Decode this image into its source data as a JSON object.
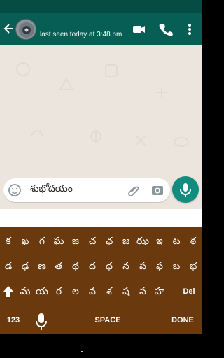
{
  "contact": {
    "last_seen": "last seen today at 3:48 pm"
  },
  "composer": {
    "message": "శుభోదయం"
  },
  "keyboard": {
    "row1": [
      "క",
      "ఖ",
      "గ",
      "ఘ",
      "జ",
      "చ",
      "ఛ",
      "జ",
      "ఝ",
      "ఇ",
      "ట",
      "ఠ"
    ],
    "row2": [
      "డ",
      "ఢ",
      "ణ",
      "త",
      "థ",
      "ద",
      "ధ",
      "న",
      "ప",
      "ఫ",
      "బ",
      "భ"
    ],
    "row3": [
      "మ",
      "య",
      "ర",
      "ల",
      "వ",
      "శ",
      "ష",
      "స",
      "హ"
    ],
    "delete_label": "Del",
    "numbers_label": "123",
    "space_label": "SPACE",
    "done_label": "DONE"
  },
  "icons": {
    "back": "back-arrow-icon",
    "video": "video-call-icon",
    "voice": "phone-call-icon",
    "menu": "more-vertical-icon",
    "emoji": "emoji-icon",
    "attach": "paperclip-icon",
    "camera": "camera-icon",
    "mic": "microphone-icon",
    "shift": "shift-up-icon"
  },
  "colors": {
    "header": "#075e54",
    "status": "#054d44",
    "chat_background": "#ece5dd",
    "accent": "#128c7e",
    "keyboard": "#6b390e"
  }
}
